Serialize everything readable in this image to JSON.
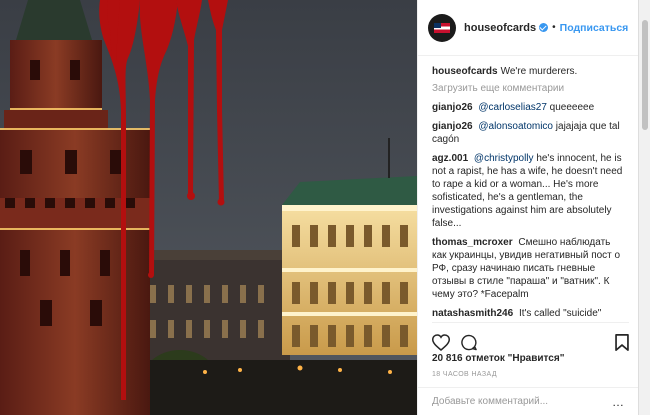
{
  "post": {
    "username": "houseofcards",
    "follow_label": "Подписаться",
    "caption_user": "houseofcards",
    "caption_text": "We're murderers.",
    "load_more": "Загрузить еще комментарии",
    "comments": [
      {
        "user": "gianjo26",
        "mention": "@carloselias27",
        "text": "queeeeee"
      },
      {
        "user": "gianjo26",
        "mention": "@alonsoatomico",
        "text": "jajajaja que tal cagón"
      },
      {
        "user": "agz.001",
        "mention": "@christypolly",
        "text": "he's innocent, he is not a rapist, he has a wife, he doesn't need to rape a kid or a woman... He's more sofisticated, he's a gentleman, the investigations against him are absolutely false..."
      },
      {
        "user": "thomas_mcroxer",
        "mention": "",
        "text": "Смешно наблюдать как украинцы, увидив негативный пост о РФ, сразу начинаю писать гневные отзывы в стиле \"параша\" и \"ватник\". К чему это? *Facepalm"
      },
      {
        "user": "natashasmith246",
        "mention": "",
        "text": "It's called \"suicide\" when you kill your own show. I have no"
      }
    ],
    "likes": "20 816 отметок \"Нравится\"",
    "time": "18 часов назад",
    "add_comment_placeholder": "Добавьте комментарий...",
    "more_icon": "…"
  },
  "colors": {
    "accent": "#3897f0",
    "text": "#262626",
    "muted": "#999999",
    "blood": "#b30f0f"
  },
  "icons": [
    "heart-icon",
    "comment-icon",
    "bookmark-icon",
    "verified-icon",
    "more-options-icon"
  ]
}
